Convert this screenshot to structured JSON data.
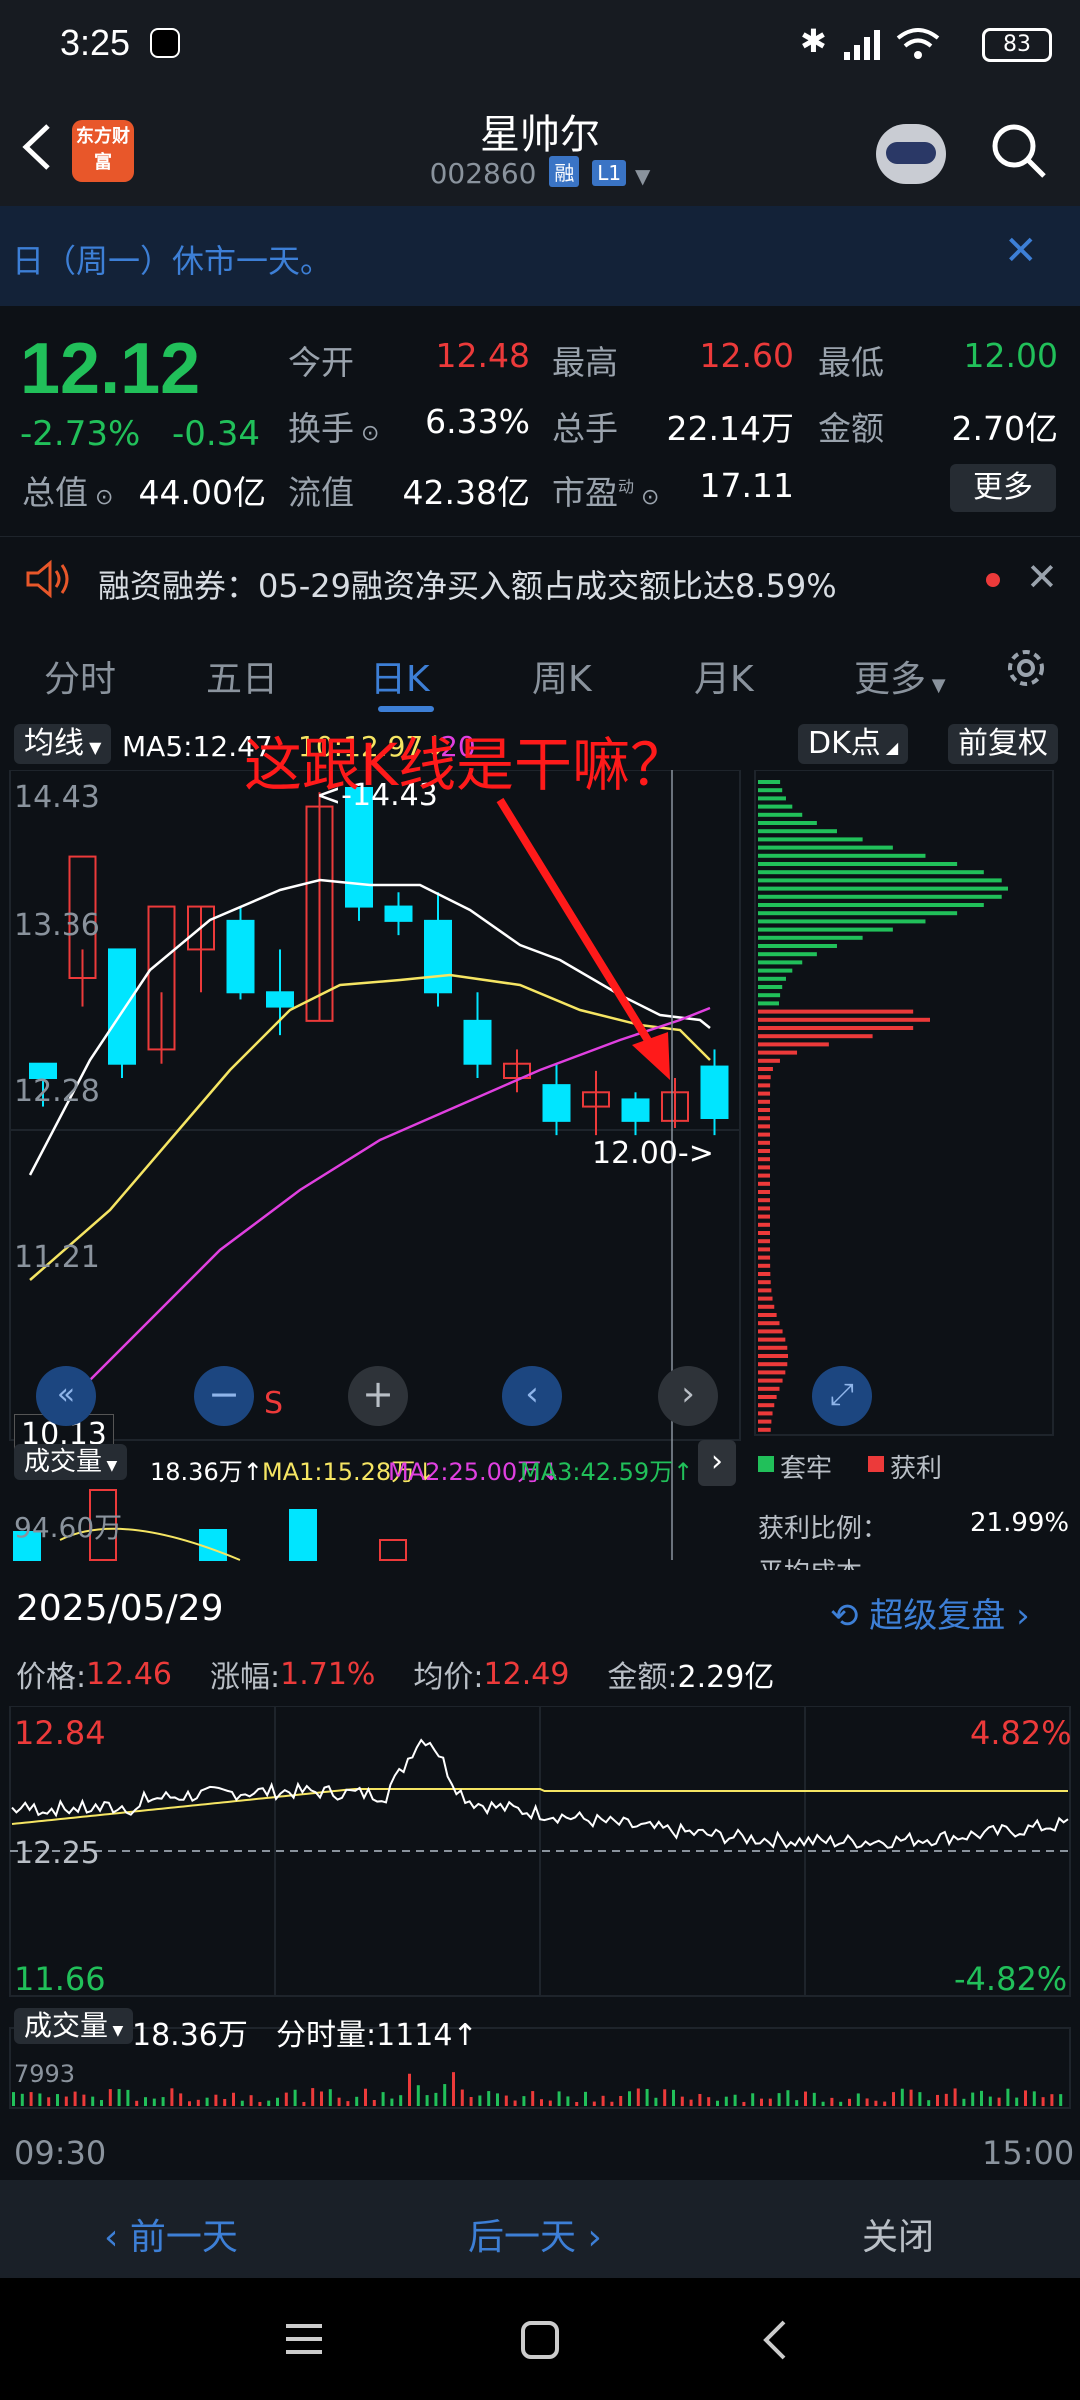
{
  "status_bar": {
    "time": "3:25",
    "battery": "83"
  },
  "header": {
    "logo_text": "东方财富",
    "name": "星帅尔",
    "code": "002860",
    "tag_margin": "融",
    "tag_level": "L1"
  },
  "notice": {
    "text": "日（周一）休市一天。"
  },
  "quote": {
    "price": "12.12",
    "change_pct": "-2.73%",
    "change": "-0.34",
    "labels": {
      "open": "今开",
      "high": "最高",
      "low": "最低",
      "turnover": "换手",
      "volume": "总手",
      "amount": "金额",
      "total_cap": "总值",
      "float_cap": "流值",
      "pe": "市盈",
      "pe_sup": "动"
    },
    "open": "12.48",
    "high": "12.60",
    "low": "12.00",
    "turnover": "6.33%",
    "volume": "22.14万",
    "amount": "2.70亿",
    "total_cap": "44.00亿",
    "float_cap": "42.38亿",
    "pe": "17.11",
    "more_button": "更多"
  },
  "margin_notice": {
    "text": "融资融券：05-29融资净买入额占成交额比达8.59%"
  },
  "tabs": [
    "分时",
    "五日",
    "日K",
    "周K",
    "月K",
    "更多"
  ],
  "chart": {
    "ma_selector": "均线",
    "ma5": "MA5:12.47",
    "ma10": "10:12.97↓",
    "ma_partial": "20",
    "dk_button": "DK点",
    "adjust_button": "前复权",
    "annotation": "这跟K线是干嘛？",
    "y_ticks": [
      "14.43",
      "13.36",
      "12.28",
      "11.21"
    ],
    "high_marker": "<-14.43",
    "low_marker": "12.00->",
    "crosshair_price": "10.13",
    "s_marker": "S",
    "volume_selector": "成交量",
    "vol_value": "18.36万↑",
    "vol_ma1": "MA1:15.28万↓",
    "vol_ma2": "MA2:25.00万↓",
    "vol_ma3": "MA3:42.59万↑",
    "vol_max": "94.60万",
    "chip_legend_trap": "套牢",
    "chip_legend_profit": "获利",
    "chip_ratio_label": "获利比例：",
    "chip_ratio_value": "21.99%",
    "chip_avg_label": "平均成本"
  },
  "replay": {
    "date": "2025/05/29",
    "super_replay": "超级复盘",
    "price_label": "价格:",
    "price": "12.46",
    "change_label": "涨幅:",
    "change": "1.71%",
    "avg_label": "均价:",
    "avg": "12.49",
    "amount_label": "金额:",
    "amount": "2.29亿",
    "y_top": "12.84",
    "y_mid": "12.25",
    "y_bot": "11.66",
    "pct_top": "4.82%",
    "pct_bot": "-4.82%",
    "vol_selector": "成交量",
    "vol_total": "18.36万",
    "vol_minute": "分时量:1114↑",
    "vol_max": "7993",
    "time_start": "09:30",
    "time_end": "15:00"
  },
  "bottom_nav": {
    "prev": "前一天",
    "next": "后一天",
    "close": "关闭"
  },
  "colors": {
    "up": "#ec3a3a",
    "down": "#21c05a",
    "accent": "#3d7fd6",
    "cyan": "#00e5ff"
  }
}
